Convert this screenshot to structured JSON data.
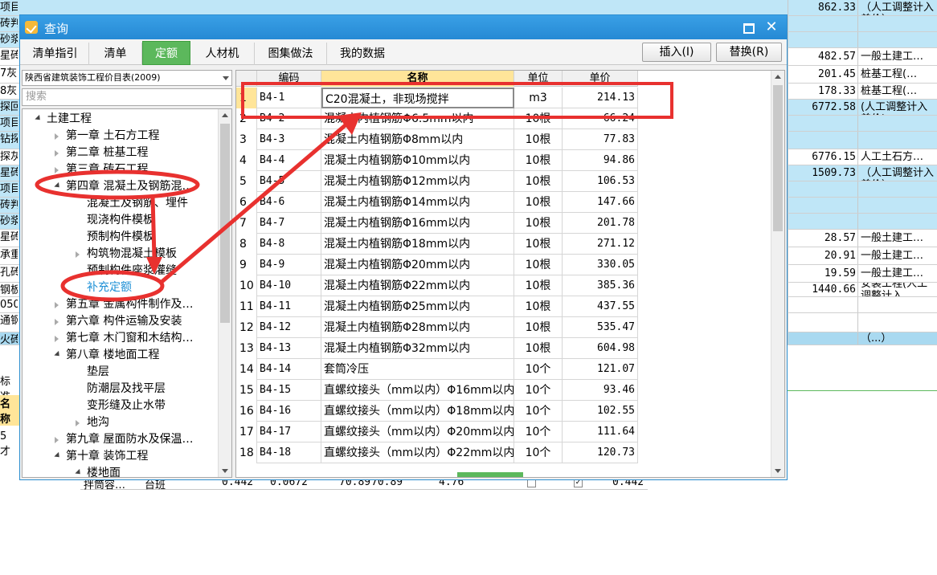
{
  "background": {
    "rows": [
      {
        "left": [
          "项目特征]"
        ],
        "amount": "862.33",
        "type": "一般土建工程（人工调整计入差价）",
        "style": "blue"
      },
      {
        "left": [
          "砖判"
        ],
        "amount": "",
        "type": "",
        "style": "blue"
      },
      {
        "left": [
          "砂浆"
        ],
        "amount": "",
        "type": "",
        "style": "blue"
      },
      {
        "left": [
          "星砖"
        ],
        "amount": "482.57",
        "type": "一般土建工…",
        "style": ""
      },
      {
        "left": [
          "7灰"
        ],
        "amount": "201.45",
        "type": "桩基工程(…",
        "style": ""
      },
      {
        "left": [
          "8灰"
        ],
        "amount": "178.33",
        "type": "桩基工程(…",
        "style": ""
      },
      {
        "left": [
          "探回"
        ],
        "amount": "6772.58",
        "type": "机械土石方工程(人工调整计入差价)",
        "style": "blue"
      },
      {
        "left": [
          "项目"
        ],
        "amount": "",
        "type": "",
        "style": "blue"
      },
      {
        "left": [
          "钻探"
        ],
        "amount": "",
        "type": "",
        "style": "blue"
      },
      {
        "left": [
          "探灰"
        ],
        "amount": "6776.15",
        "type": "人工土石方…",
        "style": ""
      },
      {
        "left": [
          "星砖"
        ],
        "amount": "1509.73",
        "type": "一般土建工程（人工调整计入差价）",
        "style": "blue"
      },
      {
        "left": [
          "项目"
        ],
        "amount": "",
        "type": "",
        "style": "blue"
      },
      {
        "left": [
          "砖判"
        ],
        "amount": "",
        "type": "",
        "style": "blue"
      },
      {
        "left": [
          "砂浆"
        ],
        "amount": "",
        "type": "",
        "style": "blue"
      },
      {
        "left": [
          "星砖"
        ],
        "amount": "28.57",
        "type": "一般土建工…",
        "style": ""
      },
      {
        "left": [
          "承重"
        ],
        "amount": "20.91",
        "type": "一般土建工…",
        "style": ""
      },
      {
        "left": [
          "孔砖"
        ],
        "amount": "19.59",
        "type": "一般土建工…",
        "style": ""
      },
      {
        "left": [
          "钢板"
        ],
        "amount": "1440.66",
        "type": "安装工程(人工调整计入…",
        "style": ""
      },
      {
        "left": [
          "050"
        ],
        "amount": "",
        "type": "",
        "style": ""
      },
      {
        "left": [
          "通钢"
        ],
        "amount": "",
        "type": "",
        "style": ""
      },
      {
        "left": [
          "火砖"
        ],
        "amount": "",
        "type": "（...）",
        "style": "blue2"
      }
    ],
    "lower_left": [
      "标准",
      "名称",
      "5 才"
    ],
    "bottom_row": [
      "拌筒容…",
      "台班",
      "0.442",
      "0.0672",
      "70.89",
      "70.89",
      "4.76",
      "0.442"
    ]
  },
  "dialog": {
    "title": "查询",
    "tabs": [
      "清单指引",
      "清单",
      "定额",
      "人材机",
      "图集做法",
      "我的数据"
    ],
    "active_tab": "定额",
    "insert_button": "插入(I)",
    "replace_button": "替换(R)",
    "library": "陕西省建筑装饰工程价目表(2009)",
    "search_placeholder": "搜索",
    "tree": [
      {
        "label": "土建工程",
        "level": 0,
        "state": "expanded"
      },
      {
        "label": "第一章  土石方工程",
        "level": 1,
        "state": "collapsed"
      },
      {
        "label": "第二章  桩基工程",
        "level": 1,
        "state": "collapsed"
      },
      {
        "label": "第三章  砖石工程",
        "level": 1,
        "state": "collapsed"
      },
      {
        "label": "第四章  混凝土及钢筋混…",
        "level": 1,
        "state": "expanded"
      },
      {
        "label": "混凝土及钢筋、埋件",
        "level": 2,
        "state": "leaf"
      },
      {
        "label": "现浇构件模板",
        "level": 2,
        "state": "leaf"
      },
      {
        "label": "预制构件模板",
        "level": 2,
        "state": "leaf"
      },
      {
        "label": "构筑物混凝土模板",
        "level": 2,
        "state": "collapsed"
      },
      {
        "label": "预制构件座浆灌缝",
        "level": 2,
        "state": "leaf"
      },
      {
        "label": "补充定额",
        "level": 2,
        "state": "leaf",
        "selected": true
      },
      {
        "label": "第五章  金属构件制作及…",
        "level": 1,
        "state": "collapsed"
      },
      {
        "label": "第六章  构件运输及安装",
        "level": 1,
        "state": "collapsed"
      },
      {
        "label": "第七章  木门窗和木结构…",
        "level": 1,
        "state": "collapsed"
      },
      {
        "label": "第八章  楼地面工程",
        "level": 1,
        "state": "expanded"
      },
      {
        "label": "垫层",
        "level": 2,
        "state": "leaf"
      },
      {
        "label": "防潮层及找平层",
        "level": 2,
        "state": "leaf"
      },
      {
        "label": "变形缝及止水带",
        "level": 2,
        "state": "leaf"
      },
      {
        "label": "地沟",
        "level": 2,
        "state": "collapsed"
      },
      {
        "label": "第九章  屋面防水及保温…",
        "level": 1,
        "state": "collapsed"
      },
      {
        "label": "第十章  装饰工程",
        "level": 1,
        "state": "expanded"
      },
      {
        "label": "楼地面",
        "level": 2,
        "state": "expanded"
      }
    ],
    "grid": {
      "columns": [
        "编码",
        "名称",
        "单位",
        "单价"
      ],
      "rows": [
        {
          "idx": "1",
          "code": "B4-1",
          "name": "C20混凝土，非现场搅拌",
          "unit": "m3",
          "price": "214.13"
        },
        {
          "idx": "2",
          "code": "B4-2",
          "name": "混凝土内植钢筋Φ6.5mm以内",
          "unit": "10根",
          "price": "66.24"
        },
        {
          "idx": "3",
          "code": "B4-3",
          "name": "混凝土内植钢筋Φ8mm以内",
          "unit": "10根",
          "price": "77.83"
        },
        {
          "idx": "4",
          "code": "B4-4",
          "name": "混凝土内植钢筋Φ10mm以内",
          "unit": "10根",
          "price": "94.86"
        },
        {
          "idx": "5",
          "code": "B4-5",
          "name": "混凝土内植钢筋Φ12mm以内",
          "unit": "10根",
          "price": "106.53"
        },
        {
          "idx": "6",
          "code": "B4-6",
          "name": "混凝土内植钢筋Φ14mm以内",
          "unit": "10根",
          "price": "147.66"
        },
        {
          "idx": "7",
          "code": "B4-7",
          "name": "混凝土内植钢筋Φ16mm以内",
          "unit": "10根",
          "price": "201.78"
        },
        {
          "idx": "8",
          "code": "B4-8",
          "name": "混凝土内植钢筋Φ18mm以内",
          "unit": "10根",
          "price": "271.12"
        },
        {
          "idx": "9",
          "code": "B4-9",
          "name": "混凝土内植钢筋Φ20mm以内",
          "unit": "10根",
          "price": "330.05"
        },
        {
          "idx": "10",
          "code": "B4-10",
          "name": "混凝土内植钢筋Φ22mm以内",
          "unit": "10根",
          "price": "385.36"
        },
        {
          "idx": "11",
          "code": "B4-11",
          "name": "混凝土内植钢筋Φ25mm以内",
          "unit": "10根",
          "price": "437.55"
        },
        {
          "idx": "12",
          "code": "B4-12",
          "name": "混凝土内植钢筋Φ28mm以内",
          "unit": "10根",
          "price": "535.47"
        },
        {
          "idx": "13",
          "code": "B4-13",
          "name": "混凝土内植钢筋Φ32mm以内",
          "unit": "10根",
          "price": "604.98"
        },
        {
          "idx": "14",
          "code": "B4-14",
          "name": "套筒冷压",
          "unit": "10个",
          "price": "121.07"
        },
        {
          "idx": "15",
          "code": "B4-15",
          "name": "直螺纹接头（mm以内）Φ16mm以内",
          "unit": "10个",
          "price": "93.46"
        },
        {
          "idx": "16",
          "code": "B4-16",
          "name": "直螺纹接头（mm以内）Φ18mm以内",
          "unit": "10个",
          "price": "102.55"
        },
        {
          "idx": "17",
          "code": "B4-17",
          "name": "直螺纹接头（mm以内）Φ20mm以内",
          "unit": "10个",
          "price": "111.64"
        },
        {
          "idx": "18",
          "code": "B4-18",
          "name": "直螺纹接头（mm以内）Φ22mm以内",
          "unit": "10个",
          "price": "120.73"
        }
      ]
    }
  },
  "colors": {
    "titlebar": "#2589d4",
    "active_tab": "#5cb85c",
    "annotation": "#e8312f",
    "selected_tree": "#1e90d6",
    "header_highlight": "#ffe599"
  }
}
